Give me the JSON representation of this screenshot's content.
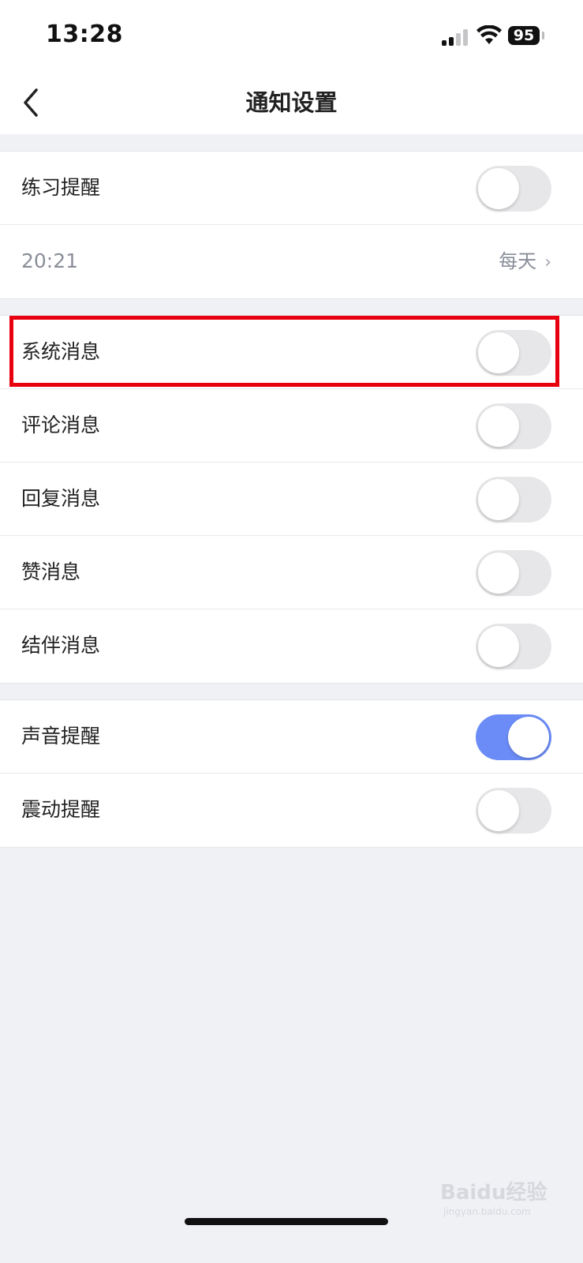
{
  "status_bar": {
    "time": "13:28",
    "battery": "95"
  },
  "nav": {
    "title": "通知设置"
  },
  "groups": [
    {
      "rows": [
        {
          "label": "练习提醒",
          "toggle": false
        },
        {
          "time_value": "20:21",
          "repeat": "每天"
        }
      ]
    },
    {
      "rows": [
        {
          "label": "系统消息",
          "toggle": false
        },
        {
          "label": "评论消息",
          "toggle": false
        },
        {
          "label": "回复消息",
          "toggle": false
        },
        {
          "label": "赞消息",
          "toggle": false
        },
        {
          "label": "结伴消息",
          "toggle": false
        }
      ]
    },
    {
      "rows": [
        {
          "label": "声音提醒",
          "toggle": true
        },
        {
          "label": "震动提醒",
          "toggle": false
        }
      ]
    }
  ],
  "accent_color": "#6b8cf7",
  "highlight_color": "#e8000e",
  "watermark": {
    "text": "Baidu经验",
    "sub": "jingyan.baidu.com"
  }
}
